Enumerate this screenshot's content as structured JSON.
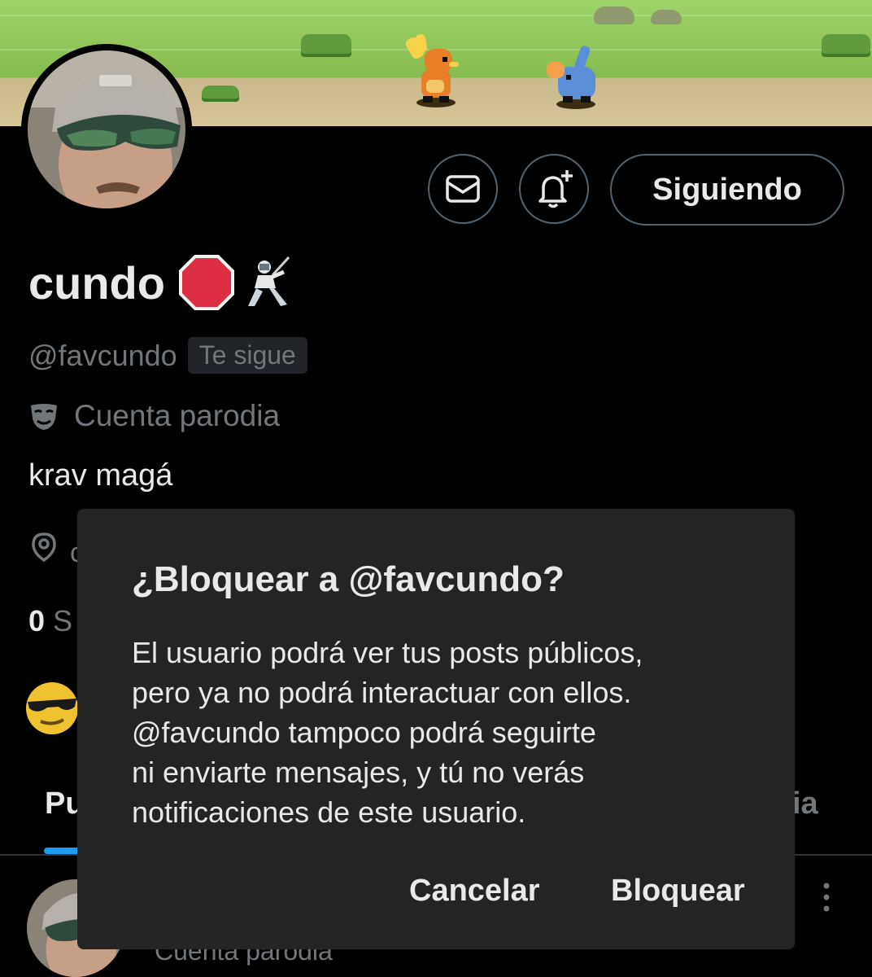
{
  "profile": {
    "display_name": "cundo",
    "handle": "@favcundo",
    "follows_you_badge": "Te sigue",
    "parody_label": "Cuenta parodia",
    "bio": "krav magá",
    "follow_button_label": "Siguiendo",
    "name_emojis": [
      "stop-sign",
      "fencer"
    ]
  },
  "background_fragments": {
    "location_text_fragment": "c",
    "follow_count_number": "0",
    "follow_count_fragment": "S",
    "tab_left_fragment": "Pu",
    "tab_right_fragment": "ia",
    "post_subline_fragment": "Cuenta parodia"
  },
  "dialog": {
    "title": "¿Bloquear a @favcundo?",
    "body_lines": [
      "El usuario podrá ver tus posts públicos,",
      "pero ya no podrá interactuar con ellos.",
      "@favcundo tampoco podrá seguirte",
      "ni enviarte mensajes, y tú no verás",
      "notificaciones de este usuario."
    ],
    "cancel_label": "Cancelar",
    "confirm_label": "Bloquear"
  },
  "icons": {
    "message": "envelope-icon",
    "notifications": "bell-plus-icon",
    "parody": "mask-icon",
    "location": "location-pin-icon",
    "more": "more-vertical-icon"
  },
  "colors": {
    "background": "#000000",
    "dialog": "#242424",
    "muted_text": "#71767b",
    "accent": "#1d9bf0",
    "border": "#536471"
  }
}
